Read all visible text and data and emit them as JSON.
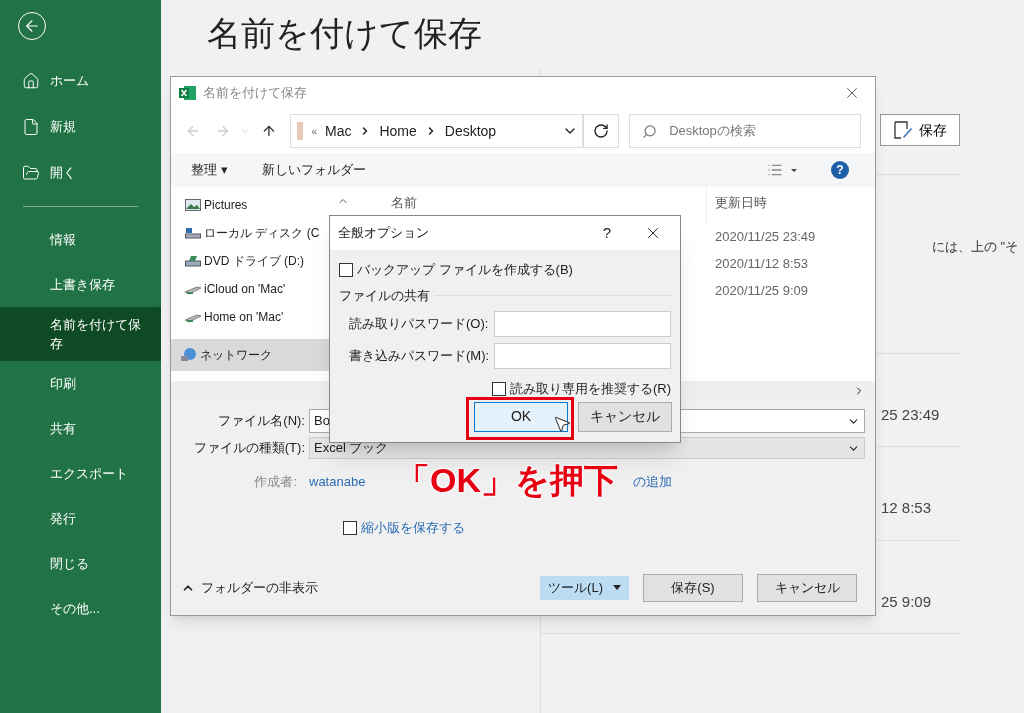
{
  "backstage": {
    "nav_top": [
      {
        "kind": "home",
        "label": "ホーム"
      },
      {
        "kind": "new",
        "label": "新規"
      },
      {
        "kind": "open",
        "label": "開く"
      }
    ],
    "nav_items": [
      {
        "label": "情報",
        "selected": false
      },
      {
        "label": "上書き保存",
        "selected": false
      },
      {
        "label": "名前を付けて保存",
        "selected": true
      },
      {
        "label": "印刷",
        "selected": false
      },
      {
        "label": "共有",
        "selected": false
      },
      {
        "label": "エクスポート",
        "selected": false
      },
      {
        "label": "発行",
        "selected": false
      },
      {
        "label": "閉じる",
        "selected": false
      },
      {
        "label": "その他...",
        "selected": false
      }
    ],
    "title": "名前を付けて保存",
    "save_button": "保存",
    "hint_text": "には、上の \"そ",
    "dates": [
      "25 23:49",
      "12 8:53",
      "25 9:09"
    ]
  },
  "save_dialog": {
    "title": "名前を付けて保存",
    "address": [
      "«",
      "Mac",
      "Home",
      "Desktop"
    ],
    "search": {
      "placeholder": "Desktopの検索"
    },
    "toolbar": {
      "organize": "整理",
      "organize_caret": "▾",
      "new_folder": "新しいフォルダー",
      "help": "?"
    },
    "nav_pane": [
      {
        "kind": "pictures",
        "label": "Pictures",
        "selected": false
      },
      {
        "kind": "disk",
        "label": "ローカル ディスク (C",
        "selected": false
      },
      {
        "kind": "dvd",
        "label": "DVD ドライブ (D:)",
        "selected": false
      },
      {
        "kind": "share",
        "label": "iCloud on 'Mac'",
        "selected": false
      },
      {
        "kind": "share",
        "label": "Home on 'Mac'",
        "selected": false
      },
      {
        "kind": "network",
        "label": "ネットワーク",
        "selected": true
      }
    ],
    "columns": [
      "名前",
      "更新日時"
    ],
    "dates": [
      "2020/11/25 23:49",
      "2020/11/12 8:53",
      "2020/11/25 9:09"
    ],
    "file_name": {
      "label": "ファイル名(N):",
      "value": "Bo"
    },
    "file_type": {
      "label": "ファイルの種類(T):",
      "value": "Excel ブック"
    },
    "author": {
      "label": "作成者:",
      "value": "watanabe"
    },
    "tags_link": "の追加",
    "thumbnail": {
      "label": "縮小版を保存する",
      "checked": false
    },
    "hide_folders": "フォルダーの非表示",
    "tools": "ツール(L)",
    "buttons": [
      "保存(S)",
      "キャンセル"
    ]
  },
  "options_dialog": {
    "title": "全般オプション",
    "help": "?",
    "backup": {
      "label": "バックアップ ファイルを作成する(B)",
      "checked": false
    },
    "group": "ファイルの共有",
    "fields": [
      {
        "label": "読み取りパスワード(O):"
      },
      {
        "label": "書き込みパスワード(M):"
      }
    ],
    "read_only": {
      "label": "読み取り専用を推奨する(R)",
      "checked": false
    },
    "buttons": [
      {
        "label": "OK",
        "default": true
      },
      {
        "label": "キャンセル",
        "default": false
      }
    ]
  },
  "annotation": "「OK」を押下"
}
